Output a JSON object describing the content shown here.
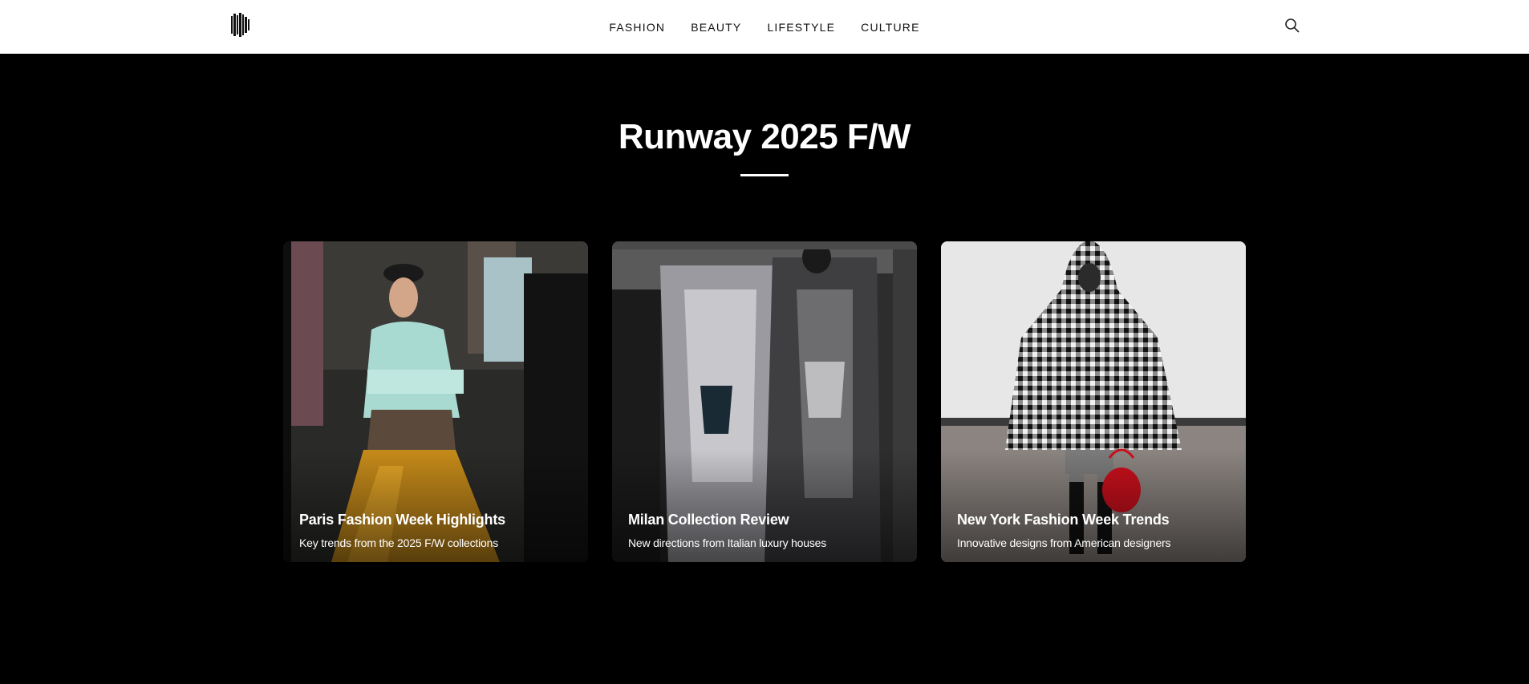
{
  "header": {
    "nav": [
      "FASHION",
      "BEAUTY",
      "LIFESTYLE",
      "CULTURE"
    ]
  },
  "section": {
    "title": "Runway 2025 F/W"
  },
  "cards": [
    {
      "title": "Paris Fashion Week Highlights",
      "subtitle": "Key trends from the 2025 F/W collections"
    },
    {
      "title": "Milan Collection Review",
      "subtitle": "New directions from Italian luxury houses"
    },
    {
      "title": "New York Fashion Week Trends",
      "subtitle": "Innovative designs from American designers"
    }
  ],
  "icons": {
    "logo": "logo-icon",
    "search": "search-icon"
  }
}
